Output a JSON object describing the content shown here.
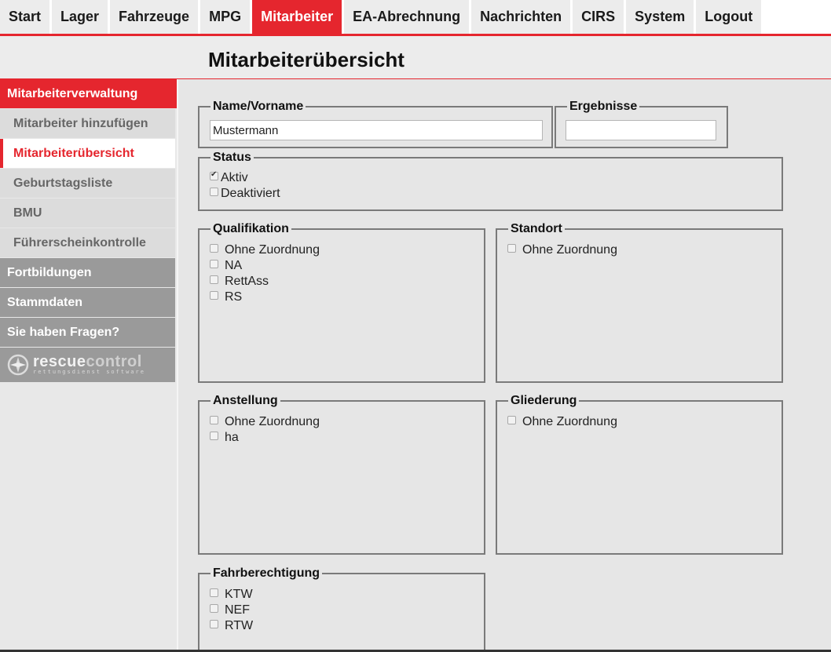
{
  "nav": {
    "tabs": [
      {
        "label": "Start"
      },
      {
        "label": "Lager"
      },
      {
        "label": "Fahrzeuge"
      },
      {
        "label": "MPG"
      },
      {
        "label": "Mitarbeiter"
      },
      {
        "label": "EA-Abrechnung"
      },
      {
        "label": "Nachrichten"
      },
      {
        "label": "CIRS"
      },
      {
        "label": "System"
      },
      {
        "label": "Logout"
      }
    ],
    "active_tab": "Mitarbeiter"
  },
  "page": {
    "title": "Mitarbeiterübersicht"
  },
  "sidebar": {
    "section": "Mitarbeiterverwaltung",
    "items": [
      {
        "label": "Mitarbeiter hinzufügen"
      },
      {
        "label": "Mitarbeiterübersicht"
      },
      {
        "label": "Geburtstagsliste"
      },
      {
        "label": "BMU"
      },
      {
        "label": "Führerscheinkontrolle"
      }
    ],
    "active_item": "Mitarbeiterübersicht",
    "groups": [
      {
        "label": "Fortbildungen"
      },
      {
        "label": "Stammdaten"
      },
      {
        "label": "Sie haben Fragen?"
      }
    ],
    "logo": {
      "brand_a": "rescue",
      "brand_b": "control",
      "tagline": "rettungsdienst software"
    }
  },
  "filters": {
    "name": {
      "legend": "Name/Vorname",
      "value": "Mustermann"
    },
    "results": {
      "legend": "Ergebnisse",
      "value": ""
    },
    "status": {
      "legend": "Status",
      "options": [
        {
          "label": "Aktiv",
          "checked": true
        },
        {
          "label": "Deaktiviert",
          "checked": false
        }
      ]
    },
    "qualifikation": {
      "legend": "Qualifikation",
      "options": [
        {
          "label": "Ohne Zuordnung",
          "checked": false
        },
        {
          "label": "NA",
          "checked": false
        },
        {
          "label": "RettAss",
          "checked": false
        },
        {
          "label": "RS",
          "checked": false
        }
      ]
    },
    "standort": {
      "legend": "Standort",
      "options": [
        {
          "label": "Ohne Zuordnung",
          "checked": false
        }
      ]
    },
    "anstellung": {
      "legend": "Anstellung",
      "options": [
        {
          "label": "Ohne Zuordnung",
          "checked": false
        },
        {
          "label": "ha",
          "checked": false
        }
      ]
    },
    "gliederung": {
      "legend": "Gliederung",
      "options": [
        {
          "label": "Ohne Zuordnung",
          "checked": false
        }
      ]
    },
    "fahrberechtigung": {
      "legend": "Fahrberechtigung",
      "options": [
        {
          "label": "KTW",
          "checked": false
        },
        {
          "label": "NEF",
          "checked": false
        },
        {
          "label": "RTW",
          "checked": false
        }
      ]
    }
  },
  "colors": {
    "accent": "#e5262e",
    "sidebar_group": "#9a9a9a",
    "background": "#e6e6e6"
  }
}
